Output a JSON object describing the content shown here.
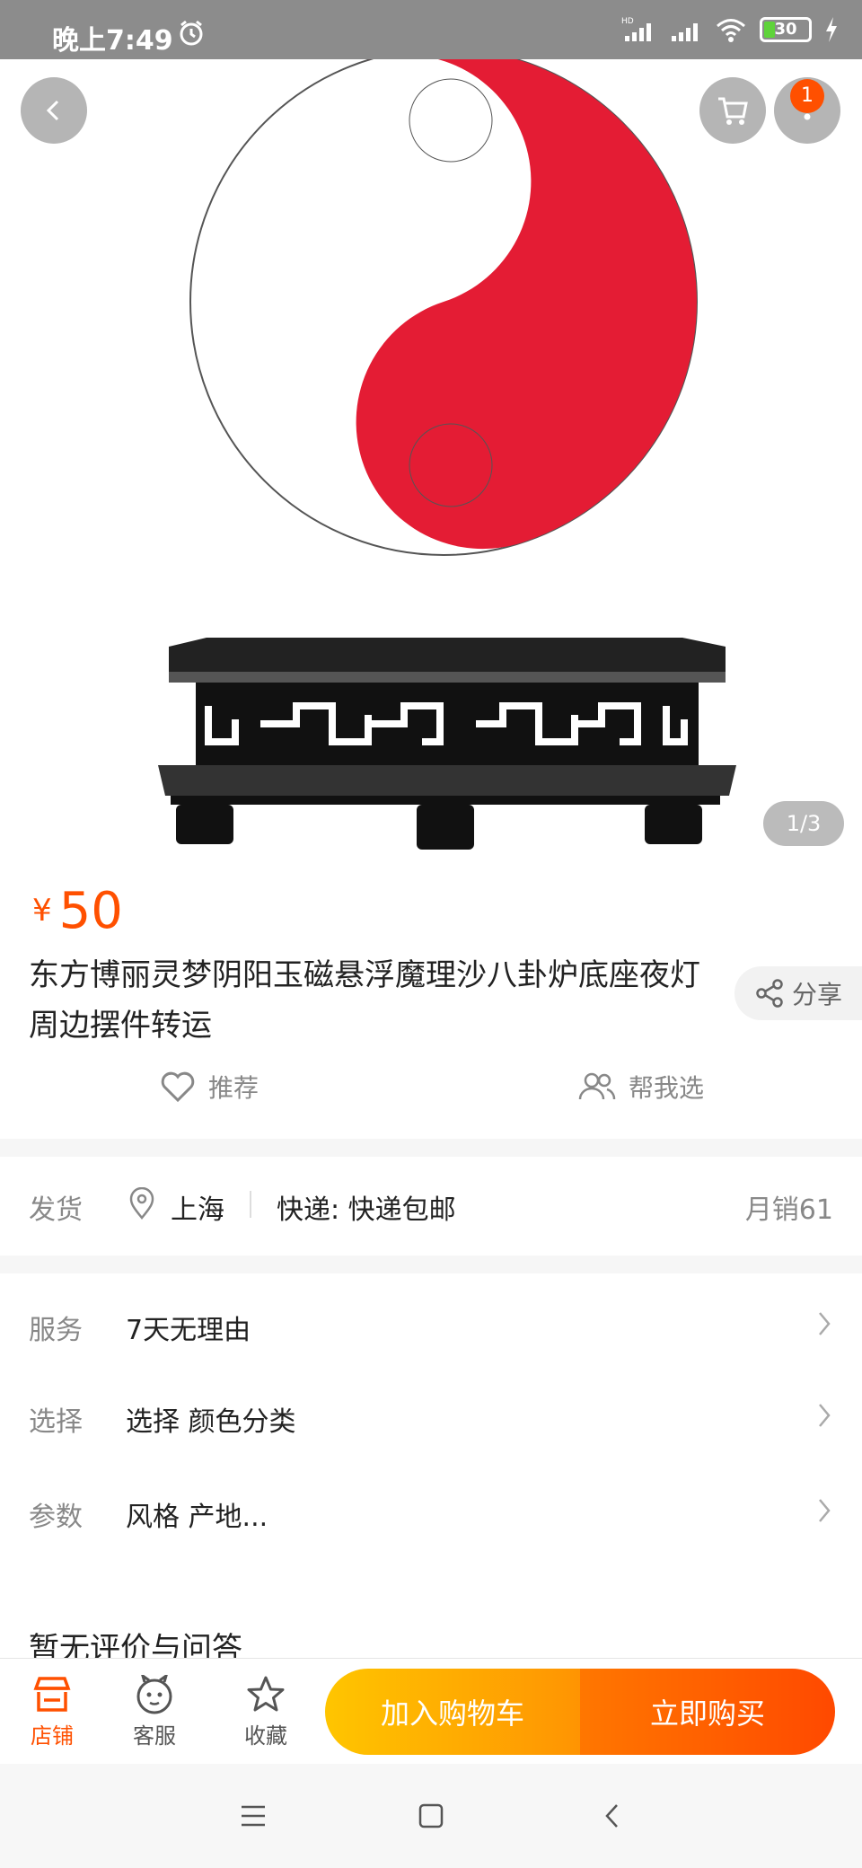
{
  "status_bar": {
    "time": "晚上7:49",
    "battery": "30",
    "network_tag": "HD"
  },
  "gallery": {
    "page_indicator": "1/3",
    "cart_badge": "1"
  },
  "product": {
    "currency": "¥",
    "price": "50",
    "title": "东方博丽灵梦阴阳玉磁悬浮魔理沙八卦炉底座夜灯周边摆件转运",
    "share_label": "分享",
    "recommend_label": "推荐",
    "help_choose_label": "帮我选"
  },
  "shipping": {
    "label": "发货",
    "location": "上海",
    "express": "快递: 快递包邮",
    "monthly_sales": "月销61"
  },
  "info_rows": [
    {
      "label": "服务",
      "value": "7天无理由"
    },
    {
      "label": "选择",
      "value": "选择 颜色分类"
    },
    {
      "label": "参数",
      "value": "风格 产地..."
    }
  ],
  "reviews_heading": "暂无评价与问答",
  "bottom_bar": {
    "shop_label": "店铺",
    "service_label": "客服",
    "favorite_label": "收藏",
    "add_to_cart_label": "加入购物车",
    "buy_now_label": "立即购买"
  },
  "colors": {
    "accent": "#ff5000",
    "yin_yang_red": "#e41c34",
    "cart_button_start": "#ffc500",
    "buy_button_end": "#ff4900"
  }
}
